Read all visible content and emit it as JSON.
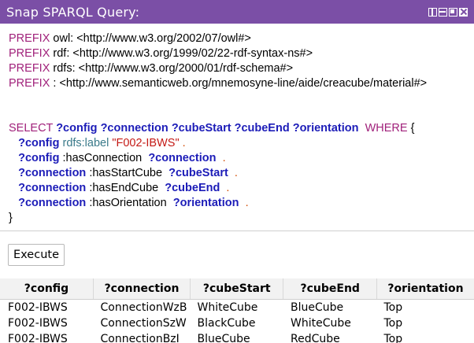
{
  "window": {
    "title": "Snap SPARQL Query:"
  },
  "query": {
    "prefixes": [
      {
        "keyword": "PREFIX",
        "text": " owl: <http://www.w3.org/2002/07/owl#>"
      },
      {
        "keyword": "PREFIX",
        "text": " rdf: <http://www.w3.org/1999/02/22-rdf-syntax-ns#>"
      },
      {
        "keyword": "PREFIX",
        "text": " rdfs: <http://www.w3.org/2000/01/rdf-schema#>"
      },
      {
        "keyword": "PREFIX",
        "text": " : <http://www.semanticweb.org/mnemosyne-line/aide/creacube/material#>"
      }
    ],
    "select_keyword": "SELECT",
    "select_vars": [
      "?config",
      "?connection",
      "?cubeStart",
      "?cubeEnd",
      "?orientation"
    ],
    "where_keyword": "WHERE",
    "open_brace": "{",
    "close_brace": "}",
    "patterns": [
      {
        "subject": "?config",
        "predicate": "rdfs:label",
        "predicate_style": "pred",
        "object": "\"F002-IBWS\"",
        "object_style": "lit",
        "end": "."
      },
      {
        "subject": "?config",
        "predicate": ":hasConnection",
        "predicate_style": "plain",
        "object": "?connection",
        "object_style": "var",
        "end": "."
      },
      {
        "subject": "?connection",
        "predicate": ":hasStartCube",
        "predicate_style": "plain",
        "object": "?cubeStart",
        "object_style": "var",
        "end": "."
      },
      {
        "subject": "?connection",
        "predicate": ":hasEndCube",
        "predicate_style": "plain",
        "object": "?cubeEnd",
        "object_style": "var",
        "end": "."
      },
      {
        "subject": "?connection",
        "predicate": ":hasOrientation",
        "predicate_style": "plain",
        "object": "?orientation",
        "object_style": "var",
        "end": "."
      }
    ]
  },
  "toolbar": {
    "execute_label": "Execute"
  },
  "results": {
    "columns": [
      "?config",
      "?connection",
      "?cubeStart",
      "?cubeEnd",
      "?orientation"
    ],
    "rows": [
      [
        "F002-IBWS",
        "ConnectionWzB",
        "WhiteCube",
        "BlueCube",
        "Top"
      ],
      [
        "F002-IBWS",
        "ConnectionSzW",
        "BlackCube",
        "WhiteCube",
        "Top"
      ],
      [
        "F002-IBWS",
        "ConnectionBzI",
        "BlueCube",
        "RedCube",
        "Top"
      ]
    ]
  }
}
